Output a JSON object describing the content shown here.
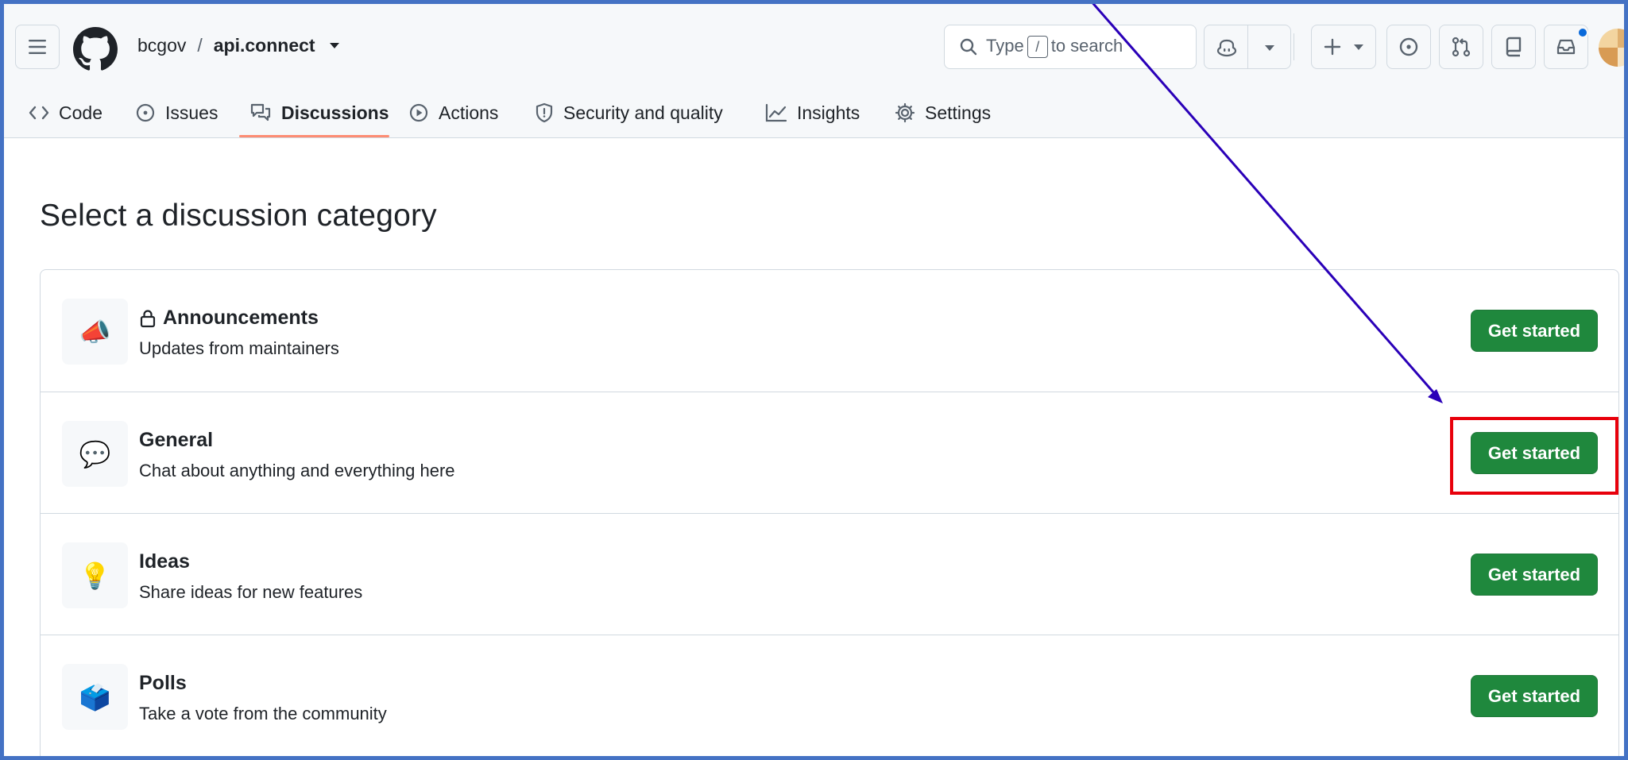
{
  "header": {
    "owner": "bcgov",
    "separator": "/",
    "repo": "api.connect",
    "search_prefix": "Type",
    "search_key": "/",
    "search_suffix": "to search"
  },
  "tabs": [
    {
      "label": "Code",
      "icon": "code-icon"
    },
    {
      "label": "Issues",
      "icon": "issue-opened-icon"
    },
    {
      "label": "Discussions",
      "icon": "comment-discussion-icon",
      "active": true
    },
    {
      "label": "Actions",
      "icon": "play-icon"
    },
    {
      "label": "Security and quality",
      "icon": "shield-icon"
    },
    {
      "label": "Insights",
      "icon": "graph-icon"
    },
    {
      "label": "Settings",
      "icon": "gear-icon"
    }
  ],
  "page": {
    "title": "Select a discussion category"
  },
  "categories": [
    {
      "emoji": "📣",
      "title": "Announcements",
      "locked": true,
      "description": "Updates from maintainers",
      "button": "Get started"
    },
    {
      "emoji": "💬",
      "title": "General",
      "locked": false,
      "description": "Chat about anything and everything here",
      "button": "Get started",
      "highlighted": true
    },
    {
      "emoji": "💡",
      "title": "Ideas",
      "locked": false,
      "description": "Share ideas for new features",
      "button": "Get started"
    },
    {
      "emoji": "🗳️",
      "title": "Polls",
      "locked": false,
      "description": "Take a vote from the community",
      "button": "Get started"
    }
  ],
  "colors": {
    "primary_button": "#1f883d",
    "tab_underline": "#fd8c73",
    "annotation_box": "#e8000b",
    "annotation_arrow": "#2a00b8",
    "frame": "#4472c4"
  }
}
